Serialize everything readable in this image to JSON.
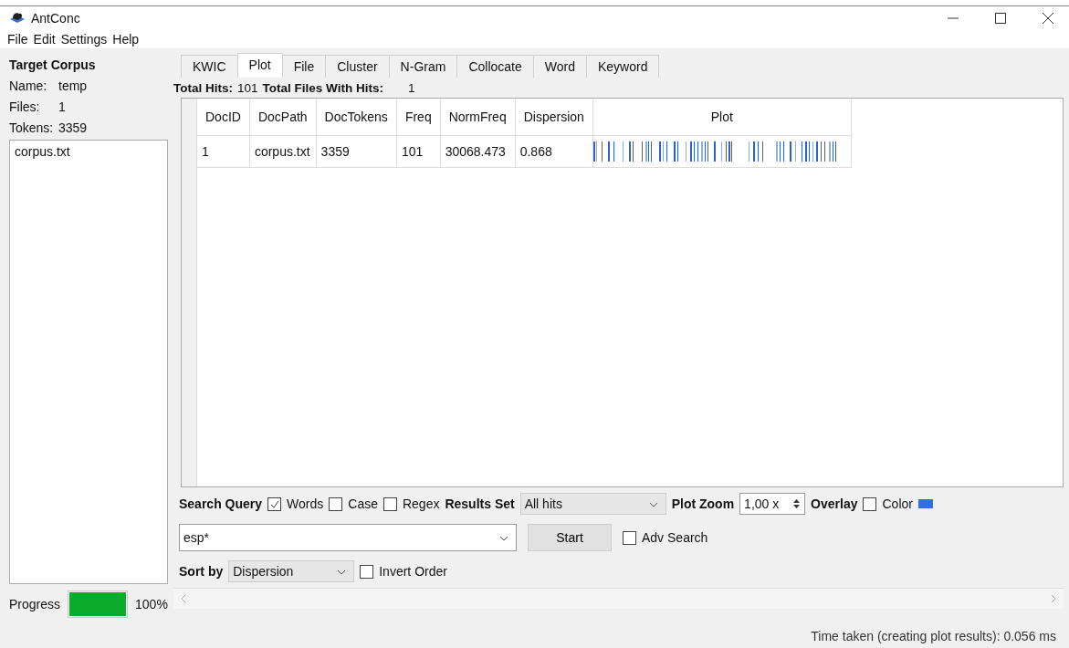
{
  "window": {
    "title": "AntConc"
  },
  "menu": [
    "File",
    "Edit",
    "Settings",
    "Help"
  ],
  "corpus": {
    "heading": "Target Corpus",
    "name_label": "Name:",
    "name": "temp",
    "files_label": "Files:",
    "files": "1",
    "tokens_label": "Tokens:",
    "tokens": "3359",
    "files_list": [
      "corpus.txt"
    ]
  },
  "progress": {
    "label": "Progress",
    "level": 1,
    "reading": "100%"
  },
  "tabs": [
    {
      "label": "KWIC",
      "selected": false
    },
    {
      "label": "Plot",
      "selected": true
    },
    {
      "label": "File",
      "selected": false
    },
    {
      "label": "Cluster",
      "selected": false
    },
    {
      "label": "N-Gram",
      "selected": false
    },
    {
      "label": "Collocate",
      "selected": false
    },
    {
      "label": "Word",
      "selected": false
    },
    {
      "label": "Keyword",
      "selected": false
    }
  ],
  "summary": {
    "hits_label": "Total Hits:",
    "hits": "101",
    "files_label": "Total Files With Hits:",
    "files": "1"
  },
  "table": {
    "columns": [
      "DocID",
      "DocPath",
      "DocTokens",
      "Freq",
      "NormFreq",
      "Dispersion",
      "Plot"
    ],
    "rows": [
      {
        "cells": [
          "1",
          "corpus.txt",
          "3359",
          "101",
          "30068.473",
          "0.868"
        ]
      }
    ]
  },
  "search": {
    "label": "Search Query",
    "options": [
      {
        "label": "Words",
        "checked": true
      },
      {
        "label": "Case",
        "checked": false
      },
      {
        "label": "Regex",
        "checked": false
      }
    ],
    "results_label": "Results Set",
    "results_value": "All hits",
    "zoom_label": "Plot Zoom",
    "zoom_value": "1,00 x",
    "overlay_label": "Overlay",
    "color_option": {
      "label": "Color",
      "checked": false
    },
    "color": "#2f6fe0",
    "query": "esp*",
    "start": "Start",
    "adv": {
      "label": "Adv Search",
      "checked": false
    },
    "sort_label": "Sort by",
    "sort_value": "Dispersion",
    "invert": {
      "label": "Invert Order",
      "checked": false
    }
  },
  "status_bar": "Time taken (creating plot results):  0.056 ms"
}
